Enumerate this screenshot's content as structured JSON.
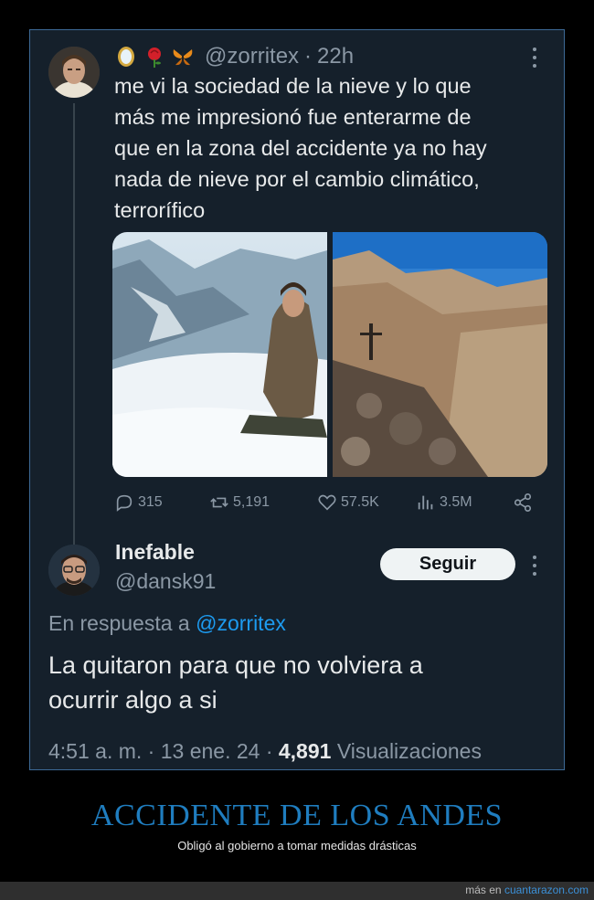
{
  "tweet": {
    "handle": "@zorritex",
    "separator": "·",
    "time": "22h",
    "text": "me vi la sociedad de la nieve y lo que\nmás me impresionó fue enterarme de\nque en la zona del accidente ya no hay\nnada de nieve por el cambio climático,\nterrorífico",
    "emoji_icons": [
      "mirror-icon",
      "rose-icon",
      "butterfly-icon"
    ],
    "stats": {
      "replies": "315",
      "retweets": "5,191",
      "likes": "57.5K",
      "views": "3.5M"
    }
  },
  "reply": {
    "name": "Inefable",
    "handle": "@dansk91",
    "follow_label": "Seguir",
    "in_reply_prefix": "En respuesta a",
    "in_reply_mention": "@zorritex",
    "text": "La quitaron para que no volviera a\nocurrir algo a si",
    "time": "4:51 a. m. · 13 ene. 24 · ",
    "views_count": "4,891",
    "views_label": "Visualizaciones"
  },
  "caption": {
    "title": "ACCIDENTE DE LOS ANDES",
    "subtitle": "Obligó al gobierno a tomar medidas drásticas"
  },
  "footer": {
    "prefix": "más en",
    "site": "cuantarazon.com"
  },
  "colors": {
    "background": "#15202b",
    "link": "#1d9bf0",
    "muted": "#8b98a5",
    "caption": "#1f7dbf"
  }
}
